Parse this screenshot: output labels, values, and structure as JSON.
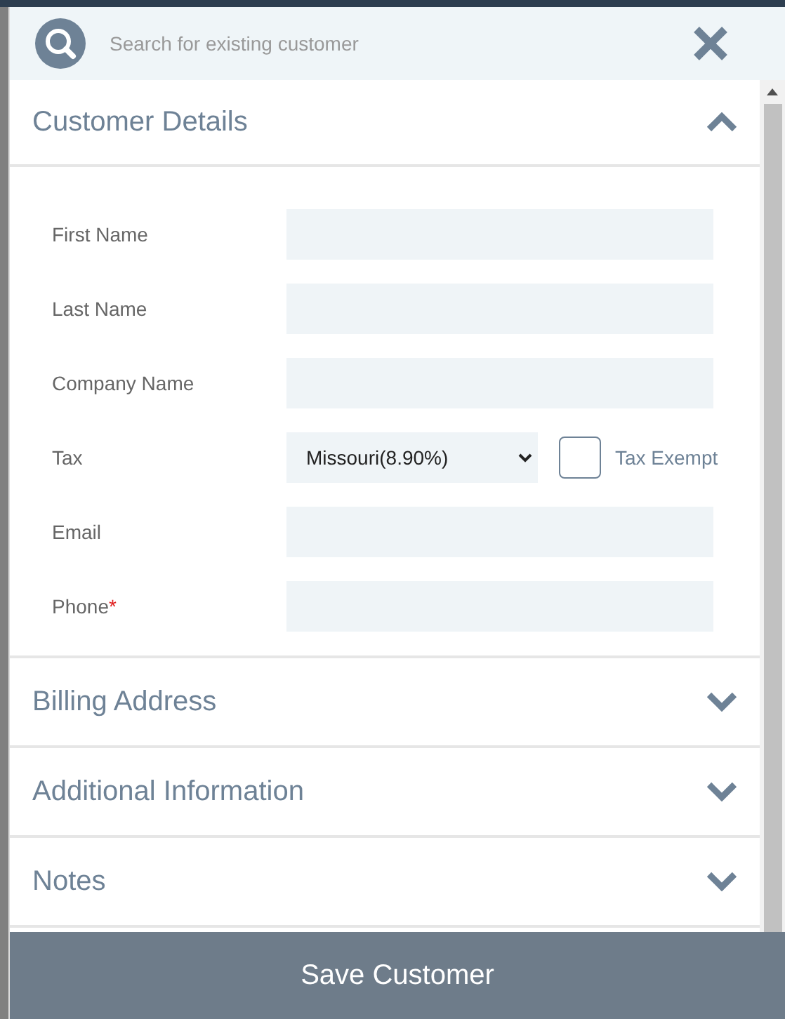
{
  "search": {
    "placeholder": "Search for existing customer"
  },
  "sections": [
    {
      "title": "Customer Details",
      "expanded": true
    },
    {
      "title": "Billing Address",
      "expanded": false
    },
    {
      "title": "Additional Information",
      "expanded": false
    },
    {
      "title": "Notes",
      "expanded": false
    }
  ],
  "fields": [
    {
      "kind": "text",
      "label": "First Name"
    },
    {
      "kind": "text",
      "label": "Last Name"
    },
    {
      "kind": "text",
      "label": "Company Name"
    },
    {
      "kind": "select",
      "label": "Tax",
      "value": "Missouri(8.90%)",
      "checkbox": {
        "label": "Tax Exempt",
        "checked": false
      }
    },
    {
      "kind": "text",
      "label": "Email"
    },
    {
      "kind": "text",
      "label": "Phone",
      "required_mark": "*"
    }
  ],
  "save_button": "Save Customer"
}
